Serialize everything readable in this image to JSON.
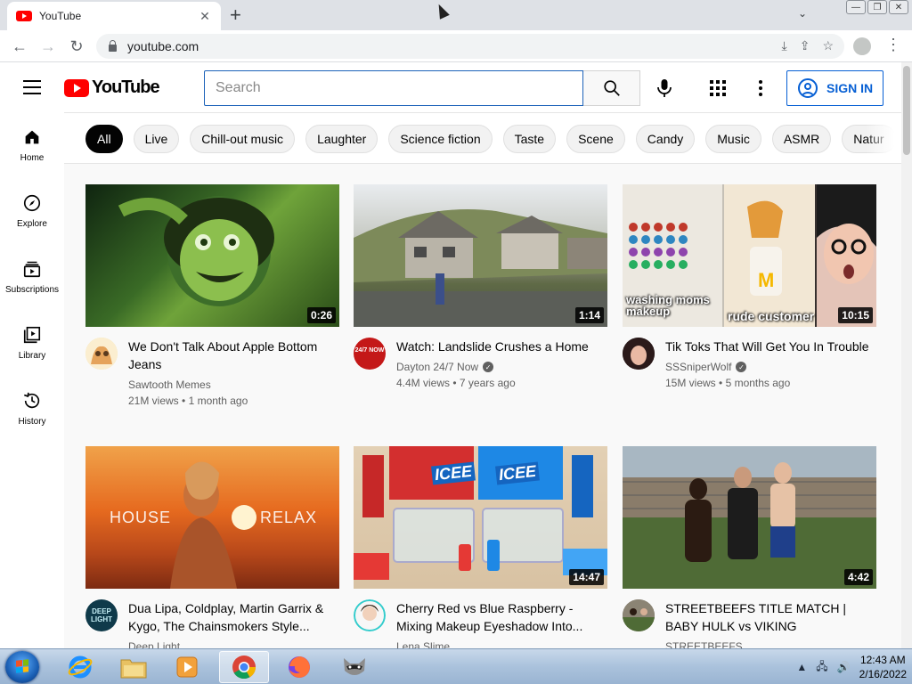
{
  "browser": {
    "tab_title": "YouTube",
    "url": "youtube.com",
    "nav": {
      "back": "←",
      "forward": "→",
      "reload": "↻"
    },
    "icons": [
      "download-icon",
      "share-icon",
      "bookmark-star-icon"
    ]
  },
  "masthead": {
    "logo_text": "YouTube",
    "search_placeholder": "Search",
    "signin_label": "SIGN IN"
  },
  "guide": [
    {
      "label": "Home",
      "icon": "home-icon"
    },
    {
      "label": "Explore",
      "icon": "compass-icon"
    },
    {
      "label": "Subscriptions",
      "icon": "subscriptions-icon"
    },
    {
      "label": "Library",
      "icon": "library-icon"
    },
    {
      "label": "History",
      "icon": "history-icon"
    }
  ],
  "chips": [
    "All",
    "Live",
    "Chill-out music",
    "Laughter",
    "Science fiction",
    "Taste",
    "Scene",
    "Candy",
    "Music",
    "ASMR",
    "Natur"
  ],
  "videos": [
    {
      "title": "We Don't Talk About Apple Bottom Jeans",
      "channel": "Sawtooth Memes",
      "verified": false,
      "views": "21M views",
      "age": "1 month ago",
      "duration": "0:26"
    },
    {
      "title": "Watch: Landslide Crushes a Home",
      "channel": "Dayton 24/7 Now",
      "verified": true,
      "views": "4.4M views",
      "age": "7 years ago",
      "duration": "1:14"
    },
    {
      "title": "Tik Toks That Will Get You In Trouble",
      "channel": "SSSniperWolf",
      "verified": true,
      "views": "15M views",
      "age": "5 months ago",
      "duration": "10:15"
    },
    {
      "title": "Dua Lipa, Coldplay, Martin Garrix & Kygo, The Chainsmokers Style...",
      "channel": "Deep Light",
      "verified": false,
      "views": "",
      "age": "",
      "duration": ""
    },
    {
      "title": "Cherry Red vs Blue Raspberry - Mixing Makeup Eyeshadow Into...",
      "channel": "Lena Slime",
      "verified": false,
      "views": "",
      "age": "",
      "duration": "14:47"
    },
    {
      "title": "STREETBEEFS TITLE MATCH | BABY HULK vs VIKING",
      "channel": "STREETBEEFS",
      "verified": false,
      "views": "",
      "age": "",
      "duration": "4:42"
    }
  ],
  "thumb_text": {
    "v3_left": "washing moms makeup",
    "v3_right": "rude customer",
    "v4_left": "HOUSE",
    "v4_right": "RELAX",
    "v5_brand": "ICEE",
    "v4_avatar": "DEEP LIGHT",
    "v2_avatar": "24/7 NOW"
  },
  "taskbar": {
    "time": "12:43 AM",
    "date": "2/16/2022"
  },
  "colors": {
    "yt_red": "#ff0000",
    "link_blue": "#065fd4",
    "text_secondary": "#606060"
  }
}
